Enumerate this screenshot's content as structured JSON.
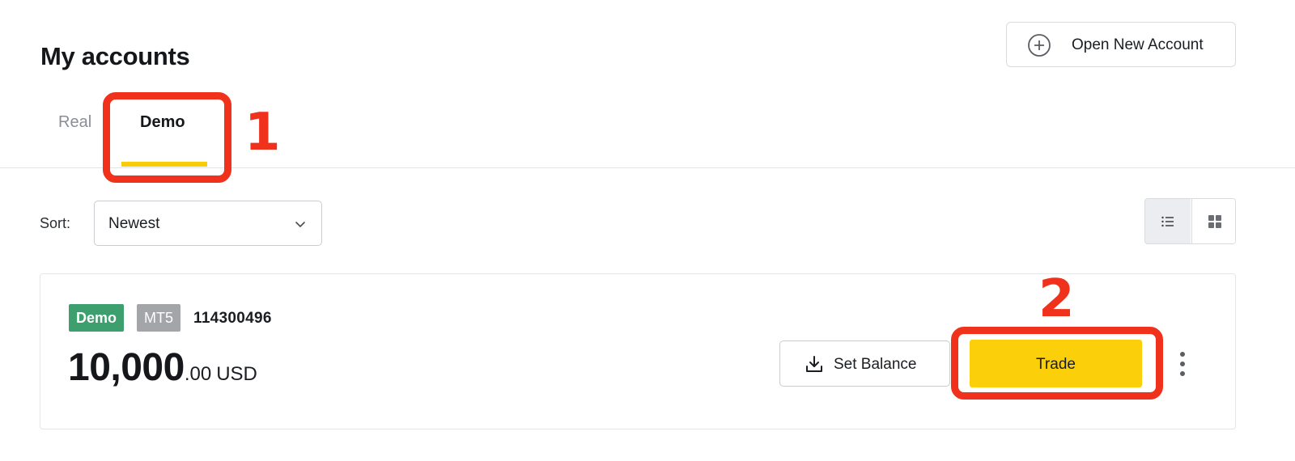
{
  "header": {
    "title": "My accounts",
    "open_account_label": "Open New Account",
    "open_account_icon": "plus-circle-icon"
  },
  "tabs": [
    {
      "label": "Real",
      "active": false
    },
    {
      "label": "Demo",
      "active": true
    }
  ],
  "sort": {
    "label": "Sort:",
    "value": "Newest",
    "icon": "chevron-down-icon"
  },
  "view_toggle": {
    "options": [
      "list-view-icon",
      "grid-view-icon"
    ],
    "selected": "list"
  },
  "account": {
    "type_badge": "Demo",
    "platform_badge": "MT5",
    "number": "114300496",
    "balance_integer": "10,000",
    "balance_decimal": ".00",
    "currency": "USD",
    "set_balance_label": "Set Balance",
    "set_balance_icon": "download-icon",
    "trade_label": "Trade",
    "more_icon": "more-vertical-icon"
  },
  "annotations": [
    {
      "number": "1"
    },
    {
      "number": "2"
    }
  ],
  "colors": {
    "accent_yellow": "#fccf0b",
    "demo_badge": "#3d9f6d",
    "platform_badge": "#a3a5a8",
    "annotation_red": "#f0311b"
  }
}
